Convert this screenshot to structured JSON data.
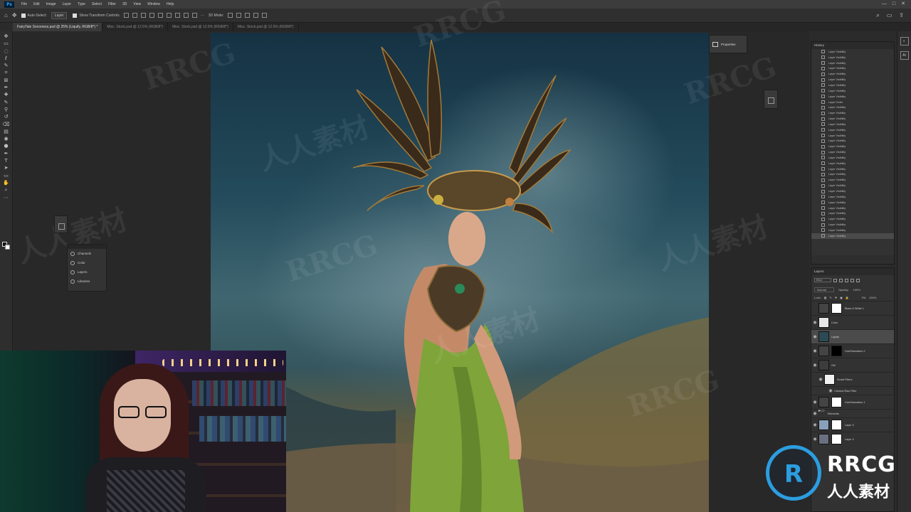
{
  "app": {
    "logo": "Ps"
  },
  "menubar": {
    "items": [
      "File",
      "Edit",
      "Image",
      "Layer",
      "Type",
      "Select",
      "Filter",
      "3D",
      "View",
      "Window",
      "Help"
    ],
    "window_controls": [
      "—",
      "□",
      "✕"
    ]
  },
  "optionsbar": {
    "auto_select": "Auto-Select:",
    "auto_select_target": "Layer",
    "show_transform": "Show Transform Controls",
    "mode_3d": "3D Mode:"
  },
  "tabs": [
    "FairyTale Sorceress.psd @ 25% (Liquify, RGB/8*) *",
    "Misc. Stock.psd @ 12.5% (RGB/8*)",
    "Misc. Stock.psd @ 12.5% (RGB/8*)",
    "Misc. Stock.psd @ 12.5% (RGB/8*)"
  ],
  "toolbar": {
    "tools": [
      "move-icon",
      "artboard-icon",
      "marquee-icon",
      "lasso-icon",
      "quick-select-icon",
      "crop-icon",
      "frame-icon",
      "eyedropper-icon",
      "spot-heal-icon",
      "brush-icon",
      "clone-stamp-icon",
      "history-brush-icon",
      "eraser-icon",
      "gradient-icon",
      "blur-icon",
      "dodge-icon",
      "pen-icon",
      "type-icon",
      "path-select-icon",
      "rectangle-icon",
      "hand-icon",
      "zoom-icon",
      "more-tools-icon"
    ],
    "glyphs": [
      "✥",
      "▭",
      "◌",
      "ℓ",
      "✎",
      "⌗",
      "⊠",
      "✒",
      "✚",
      "✎",
      "⚲",
      "↺",
      "⌫",
      "▤",
      "◉",
      "●",
      "✒",
      "T",
      "➤",
      "▭",
      "✋",
      "⌕",
      "⋯"
    ]
  },
  "channels_panel": {
    "items": [
      "Channels",
      "Color",
      "Layers",
      "Libraries"
    ]
  },
  "properties_tab": {
    "label": "Properties"
  },
  "history": {
    "title": "History",
    "items": [
      "Layer Visibility",
      "Layer Visibility",
      "Layer Visibility",
      "Layer Visibility",
      "Layer Visibility",
      "Layer Visibility",
      "Layer Visibility",
      "Layer Visibility",
      "Layer Visibility",
      "Layer Order",
      "Layer Visibility",
      "Layer Visibility",
      "Layer Visibility",
      "Layer Visibility",
      "Layer Visibility",
      "Layer Visibility",
      "Layer Visibility",
      "Layer Visibility",
      "Layer Visibility",
      "Layer Visibility",
      "Layer Visibility",
      "Layer Visibility",
      "Layer Visibility",
      "Layer Visibility",
      "Layer Visibility",
      "Layer Visibility",
      "Layer Visibility",
      "Layer Visibility",
      "Layer Visibility",
      "Layer Visibility",
      "Layer Visibility",
      "Layer Visibility",
      "Layer Visibility",
      "Layer Visibility"
    ]
  },
  "layers": {
    "title": "Layers",
    "filter_label": "Kind",
    "blend_mode": "Normal",
    "opacity_label": "Opacity:",
    "opacity_value": "100%",
    "lock_label": "Lock:",
    "fill_label": "Fill:",
    "fill_value": "100%",
    "rows": [
      {
        "name": "Black & White 1"
      },
      {
        "name": "Color"
      },
      {
        "name": "Liquify"
      },
      {
        "name": "Hue/Saturation 2"
      },
      {
        "name": "Girl"
      },
      {
        "name": "Smart Filters"
      },
      {
        "name": "Camera Raw Filter"
      },
      {
        "name": "Hue/Saturation 1"
      },
      {
        "name": "Elements"
      },
      {
        "name": "Layer 3"
      },
      {
        "name": "Layer 4"
      }
    ]
  },
  "watermark": {
    "text": "RRCG",
    "cjk": "人人素材"
  },
  "badge": {
    "line1": "RRCG",
    "line2": "人人素材",
    "monogram": "R"
  },
  "colors": {
    "accent": "#2c9de0",
    "canvas_top": "#153243",
    "dress": "#7ea43a"
  }
}
